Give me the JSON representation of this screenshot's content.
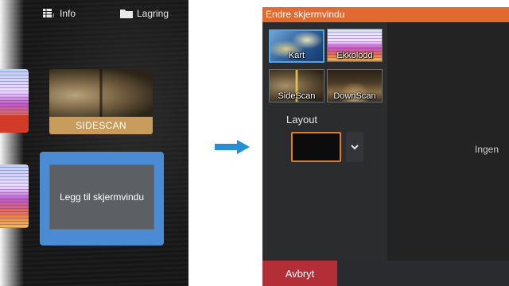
{
  "home": {
    "topbar": {
      "info_label": "Info",
      "storage_label": "Lagring",
      "info_icon": "info-grid-icon",
      "storage_icon": "folder-icon"
    },
    "tiles": {
      "sidescan_label": "SIDESCAN",
      "add_window_label": "Legg til skjermvindu"
    }
  },
  "dialog": {
    "title": "Endre skjermvindu",
    "apps": [
      {
        "label": "Kart",
        "icon": "chart-map-icon"
      },
      {
        "label": "Ekkolodd",
        "icon": "sonar-icon"
      },
      {
        "label": "SideScan",
        "icon": "sidescan-icon"
      },
      {
        "label": "DownScan",
        "icon": "downscan-icon"
      }
    ],
    "layout_label": "Layout",
    "empty_text": "Ingen",
    "cancel_label": "Avbryt"
  },
  "colors": {
    "accent_orange": "#e06a2f",
    "selection_blue": "#4a8bd4",
    "cancel_red": "#b42e38",
    "arrow_blue": "#2a8fd0"
  }
}
